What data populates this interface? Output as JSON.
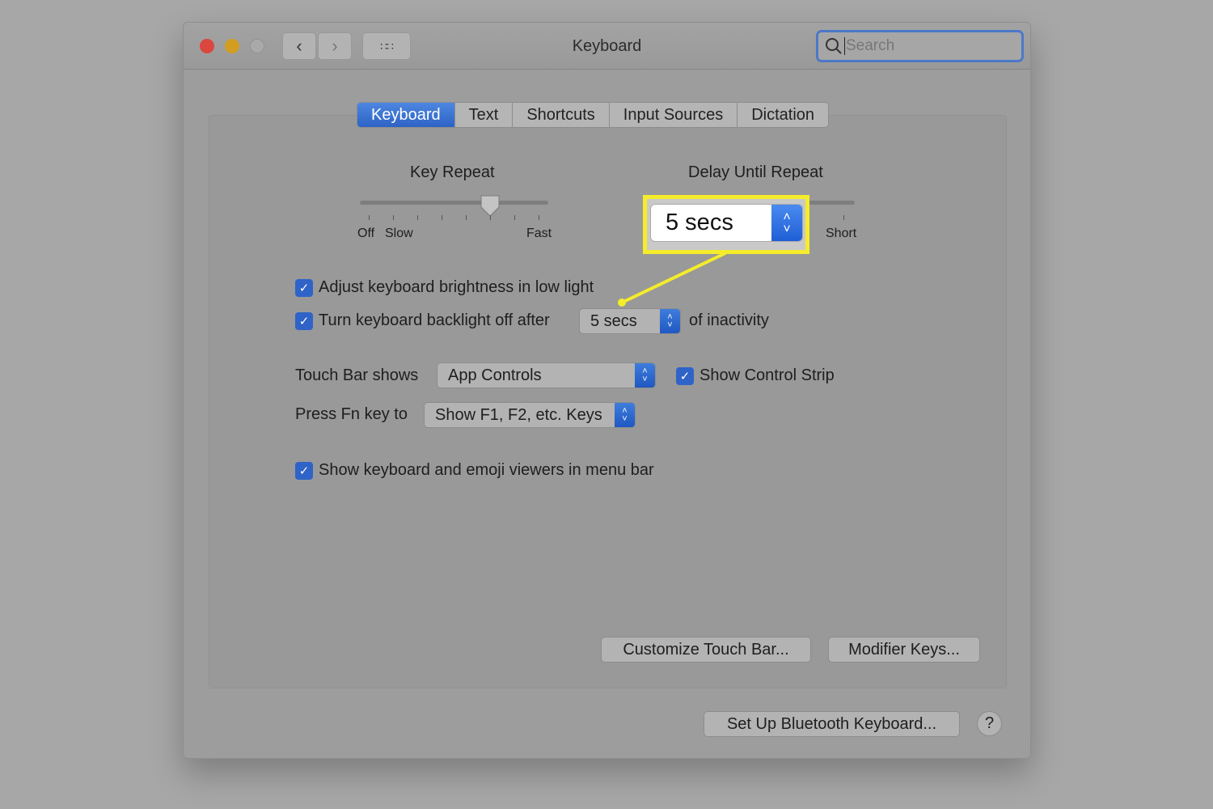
{
  "window": {
    "title": "Keyboard",
    "search_placeholder": "Search"
  },
  "tabs": [
    {
      "label": "Keyboard",
      "active": true
    },
    {
      "label": "Text"
    },
    {
      "label": "Shortcuts"
    },
    {
      "label": "Input Sources"
    },
    {
      "label": "Dictation"
    }
  ],
  "key_repeat": {
    "label": "Key Repeat",
    "off": "Off",
    "slow": "Slow",
    "fast": "Fast",
    "level": "6 of 8"
  },
  "delay_until_repeat": {
    "label": "Delay Until Repeat",
    "short": "Short"
  },
  "callout": {
    "value": "5 secs",
    "color": "#f5ec2a"
  },
  "options": {
    "adjust_brightness": {
      "label": "Adjust keyboard brightness in low light",
      "checked": true
    },
    "backlight_off": {
      "label": "Turn keyboard backlight off after",
      "value": "5 secs",
      "suffix": "of inactivity",
      "checked": true
    },
    "touch_bar": {
      "label": "Touch Bar shows",
      "value": "App Controls"
    },
    "control_strip": {
      "label": "Show Control Strip",
      "checked": true
    },
    "fn_key": {
      "label": "Press Fn key to",
      "value": "Show F1, F2, etc. Keys"
    },
    "emoji_viewers": {
      "label": "Show keyboard and emoji viewers in menu bar",
      "checked": true
    }
  },
  "buttons": {
    "customize": "Customize Touch Bar...",
    "modifier": "Modifier Keys...",
    "bluetooth": "Set Up Bluetooth Keyboard...",
    "help": "?"
  },
  "colors": {
    "accent": "#2f63c8",
    "highlight": "#f5ec2a"
  }
}
